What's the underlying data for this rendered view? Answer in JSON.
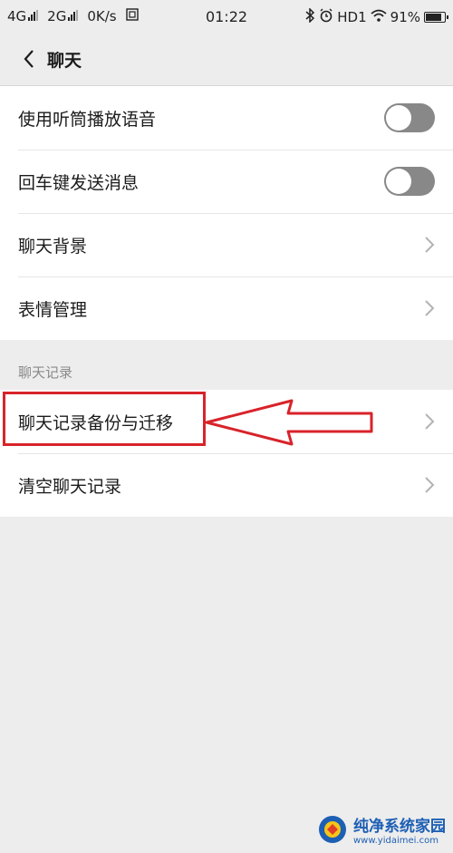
{
  "status_bar": {
    "signal1": "4G",
    "signal2": "2G",
    "speed": "0K/s",
    "time": "01:22",
    "hd": "HD1",
    "battery": "91%",
    "battery_level": 0.91
  },
  "header": {
    "title": "聊天"
  },
  "settings": {
    "items": [
      {
        "label": "使用听筒播放语音",
        "control": "toggle",
        "on": false
      },
      {
        "label": "回车键发送消息",
        "control": "toggle",
        "on": false
      },
      {
        "label": "聊天背景",
        "control": "chevron"
      },
      {
        "label": "表情管理",
        "control": "chevron"
      }
    ]
  },
  "chat_history": {
    "section_title": "聊天记录",
    "items": [
      {
        "label": "聊天记录备份与迁移",
        "control": "chevron",
        "highlighted": true
      },
      {
        "label": "清空聊天记录",
        "control": "chevron"
      }
    ]
  },
  "watermark": {
    "main": "纯净系统家园",
    "sub": "www.yidaimei.com"
  },
  "colors": {
    "background": "#ededed",
    "highlight": "#d8232a",
    "toggle_off": "#888888"
  }
}
